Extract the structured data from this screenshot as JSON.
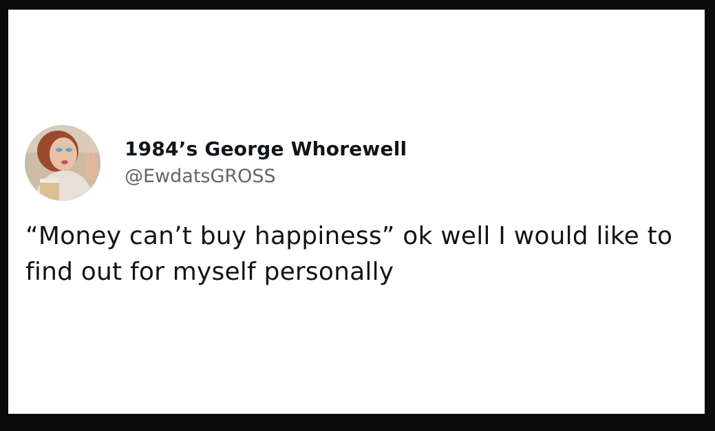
{
  "tweet": {
    "display_name": "1984’s George Whorewell",
    "handle": "@EwdatsGROSS",
    "text": "“Money can’t buy happiness” ok well I would like to find out for myself personally",
    "avatar_icon": "profile-photo"
  },
  "colors": {
    "background_outer": "#0b0b0b",
    "card": "#ffffff",
    "text_primary": "#0f1419",
    "text_secondary": "#5b6670"
  }
}
